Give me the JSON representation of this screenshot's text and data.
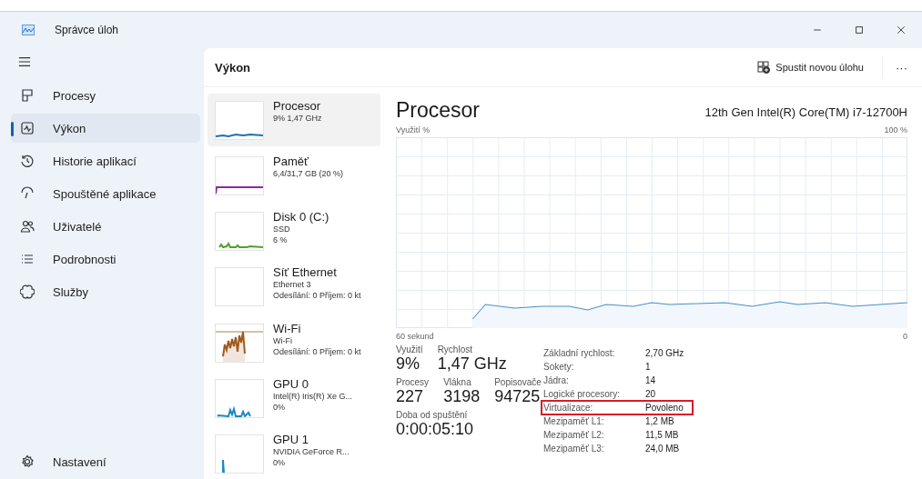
{
  "window": {
    "title": "Správce úloh"
  },
  "sidebar": {
    "items": [
      {
        "label": "Procesy",
        "selected": false
      },
      {
        "label": "Výkon",
        "selected": true
      },
      {
        "label": "Historie aplikací",
        "selected": false
      },
      {
        "label": "Spouštěné aplikace",
        "selected": false
      },
      {
        "label": "Uživatelé",
        "selected": false
      },
      {
        "label": "Podrobnosti",
        "selected": false
      },
      {
        "label": "Služby",
        "selected": false
      }
    ],
    "settings": {
      "label": "Nastavení"
    }
  },
  "header": {
    "title": "Výkon",
    "run_task": "Spustit novou úlohu",
    "more": "···"
  },
  "devices": [
    {
      "name": "Procesor",
      "lines": [
        "9% 1,47 GHz"
      ],
      "color": "#1f6fb5",
      "selected": true
    },
    {
      "name": "Paměť",
      "lines": [
        "6,4/31,7 GB (20 %)"
      ],
      "color": "#8b2a9b",
      "selected": false
    },
    {
      "name": "Disk 0 (C:)",
      "lines": [
        "SSD",
        "6 %"
      ],
      "color": "#4ca32c",
      "selected": false
    },
    {
      "name": "Síť Ethernet",
      "lines": [
        "Ethernet 3",
        "Odesílání: 0 Příjem: 0 kt"
      ],
      "selected": false
    },
    {
      "name": "Wi-Fi",
      "lines": [
        "Wi-Fi",
        "Odesílání: 0 Příjem: 0 kt"
      ],
      "color": "#a05a1c",
      "selected": false
    },
    {
      "name": "GPU 0",
      "lines": [
        "Intel(R) Iris(R) Xe G...",
        "0%"
      ],
      "color": "#1c8ac2",
      "selected": false
    },
    {
      "name": "GPU 1",
      "lines": [
        "NVIDIA GeForce R...",
        "0%"
      ],
      "color": "#1c8ac2",
      "selected": false
    }
  ],
  "detail": {
    "title": "Procesor",
    "model": "12th Gen Intel(R) Core(TM) i7-12700H",
    "graph_label": "Využití %",
    "graph_max": "100 %",
    "graph_time": "60 sekund",
    "graph_min": "0",
    "stats": [
      [
        {
          "label": "Využití",
          "value": "9%"
        },
        {
          "label": "Rychlost",
          "value": "1,47 GHz"
        }
      ],
      [
        {
          "label": "Procesy",
          "value": "227"
        },
        {
          "label": "Vlákna",
          "value": "3198"
        },
        {
          "label": "Popisovače",
          "value": "94725"
        }
      ],
      [
        {
          "label": "Doba od spuštění",
          "value": "0:00:05:10"
        }
      ]
    ],
    "properties": [
      {
        "label": "Základní rychlost:",
        "value": "2,70 GHz",
        "highlighted": false
      },
      {
        "label": "Sokety:",
        "value": "1",
        "highlighted": false
      },
      {
        "label": "Jádra:",
        "value": "14",
        "highlighted": false
      },
      {
        "label": "Logické procesory:",
        "value": "20",
        "highlighted": false
      },
      {
        "label": "Virtualizace:",
        "value": "Povoleno",
        "highlighted": true
      },
      {
        "label": "Mezipaměť L1:",
        "value": "1,2 MB",
        "highlighted": false
      },
      {
        "label": "Mezipaměť L2:",
        "value": "11,5 MB",
        "highlighted": false
      },
      {
        "label": "Mezipaměť L3:",
        "value": "24,0 MB",
        "highlighted": false
      }
    ]
  }
}
